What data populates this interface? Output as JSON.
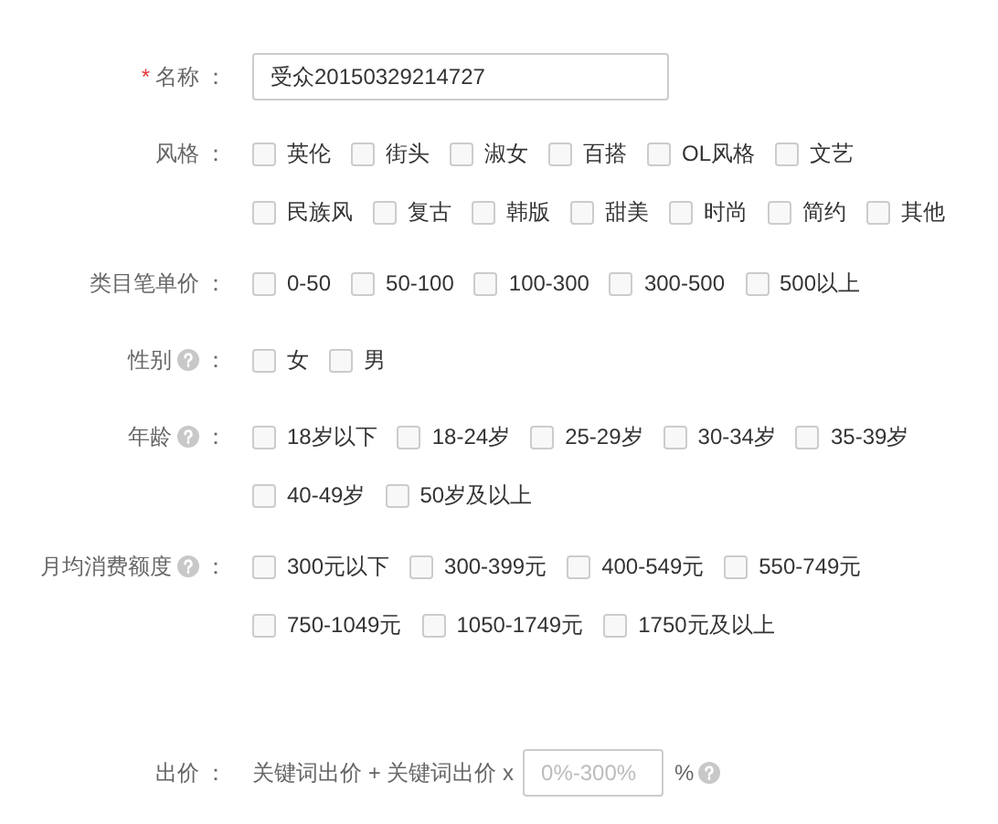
{
  "name_field": {
    "label": "名称",
    "required_mark": "*",
    "colon": "：",
    "value": "受众20150329214727"
  },
  "groups": [
    {
      "label": "风格",
      "help": false,
      "colon": "：",
      "rows": [
        [
          {
            "label": "英伦",
            "checked": false
          },
          {
            "label": "街头",
            "checked": false
          },
          {
            "label": "淑女",
            "checked": false
          },
          {
            "label": "百搭",
            "checked": false
          },
          {
            "label": "OL风格",
            "checked": false
          },
          {
            "label": "文艺",
            "checked": false
          }
        ],
        [
          {
            "label": "民族风",
            "checked": false
          },
          {
            "label": "复古",
            "checked": false
          },
          {
            "label": "韩版",
            "checked": false
          },
          {
            "label": "甜美",
            "checked": false
          },
          {
            "label": "时尚",
            "checked": false
          },
          {
            "label": "简约",
            "checked": false
          },
          {
            "label": "其他",
            "checked": false
          }
        ]
      ]
    },
    {
      "label": "类目笔单价",
      "help": false,
      "colon": "：",
      "rows": [
        [
          {
            "label": "0-50",
            "checked": false
          },
          {
            "label": "50-100",
            "checked": false
          },
          {
            "label": "100-300",
            "checked": false
          },
          {
            "label": "300-500",
            "checked": false
          },
          {
            "label": "500以上",
            "checked": false
          }
        ]
      ]
    },
    {
      "label": "性别",
      "help": true,
      "colon": "：",
      "rows": [
        [
          {
            "label": "女",
            "checked": false
          },
          {
            "label": "男",
            "checked": false
          }
        ]
      ]
    },
    {
      "label": "年龄",
      "help": true,
      "colon": "：",
      "rows": [
        [
          {
            "label": "18岁以下",
            "checked": false
          },
          {
            "label": "18-24岁",
            "checked": false
          },
          {
            "label": "25-29岁",
            "checked": false
          },
          {
            "label": "30-34岁",
            "checked": false
          },
          {
            "label": "35-39岁",
            "checked": false
          }
        ],
        [
          {
            "label": "40-49岁",
            "checked": false
          },
          {
            "label": "50岁及以上",
            "checked": false
          }
        ]
      ]
    },
    {
      "label": "月均消费额度",
      "help": true,
      "colon": "：",
      "rows": [
        [
          {
            "label": "300元以下",
            "checked": false
          },
          {
            "label": "300-399元",
            "checked": false
          },
          {
            "label": "400-549元",
            "checked": false
          },
          {
            "label": "550-749元",
            "checked": false
          }
        ],
        [
          {
            "label": "750-1049元",
            "checked": false
          },
          {
            "label": "1050-1749元",
            "checked": false
          },
          {
            "label": "1750元及以上",
            "checked": false
          }
        ]
      ]
    }
  ],
  "bid": {
    "label": "出价",
    "colon": "：",
    "formula": "关键词出价 + 关键词出价 x",
    "placeholder": "0%-300%",
    "unit": "%",
    "help": true
  }
}
